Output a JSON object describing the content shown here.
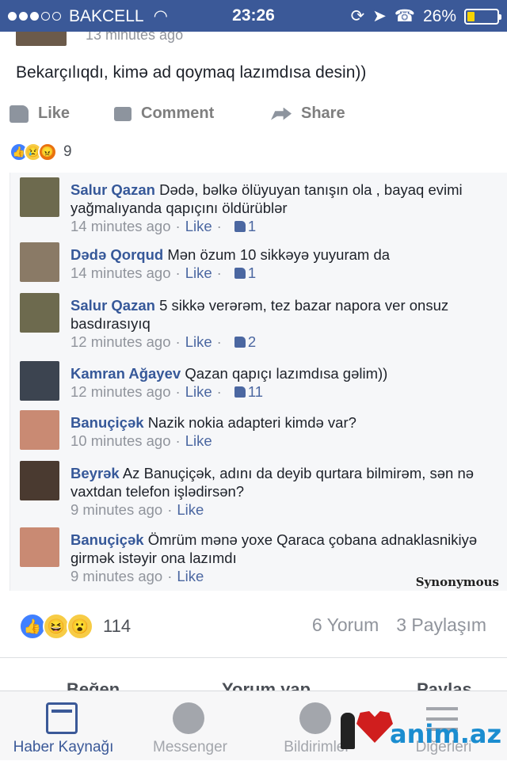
{
  "status": {
    "carrier": "BAKCELL",
    "time": "23:26",
    "battery": "26%",
    "battery_level": 0.26
  },
  "post": {
    "time": "13 minutes ago",
    "text": "Bekarçılıqdı, kimə ad qoymaq lazımdısa desin))",
    "actions": {
      "like": "Like",
      "comment": "Comment",
      "share": "Share"
    },
    "reaction_count": "9"
  },
  "comments": [
    {
      "author": "Salur Qazan",
      "text": "Dədə, bəlkə ölüyuyan tanışın ola , bayaq evimi yağmalıyanda qapıçını öldürüblər",
      "time": "14 minutes ago",
      "like": "Like",
      "likes": "1",
      "avatar_color": "#6d6a4e"
    },
    {
      "author": "Dədə Qorqud",
      "text": "Mən özum 10 sikkəyə yuyuram da",
      "time": "14 minutes ago",
      "like": "Like",
      "likes": "1",
      "avatar_color": "#8a7a66"
    },
    {
      "author": "Salur Qazan",
      "text": "5 sikkə verərəm, tez bazar napora ver onsuz basdırasıyıq",
      "time": "12 minutes ago",
      "like": "Like",
      "likes": "2",
      "avatar_color": "#6d6a4e"
    },
    {
      "author": "Kamran Ağayev",
      "text": "Qazan qapıçı lazımdısa gəlim))",
      "time": "12 minutes ago",
      "like": "Like",
      "likes": "11",
      "avatar_color": "#3c4450"
    },
    {
      "author": "Banuçiçək",
      "text": "Nazik nokia adapteri kimdə var?",
      "time": "10 minutes ago",
      "like": "Like",
      "likes": "",
      "avatar_color": "#c98a73"
    },
    {
      "author": "Beyrək",
      "text": "Az Banuçiçək, adını da deyib qurtara bilmirəm, sən nə vaxtdan telefon işlədirsən?",
      "time": "9 minutes ago",
      "like": "Like",
      "likes": "",
      "avatar_color": "#4a3a30"
    },
    {
      "author": "Banuçiçək",
      "text": "Ömrüm mənə yoxe Qaraca çobana adnaklasnikiyə girmək istəyir ona lazımdı",
      "time": "9 minutes ago",
      "like": "Like",
      "likes": "",
      "avatar_color": "#c98a73"
    }
  ],
  "watermark": "Synonymous",
  "summary": {
    "reaction_count": "114",
    "comments": "6 Yorum",
    "shares": "3 Paylaşım",
    "actions": {
      "like": "Beğen",
      "comment": "Yorum yap",
      "share": "Paylaş"
    }
  },
  "tabs": [
    {
      "label": "Haber Kaynağı"
    },
    {
      "label": "Messenger"
    },
    {
      "label": "Bildirimler"
    },
    {
      "label": "Diğerleri"
    }
  ],
  "brand": {
    "text": "anim.az"
  },
  "colors": {
    "facebook_blue": "#3b5998",
    "link": "#365899",
    "meta_gray": "#90949c"
  }
}
